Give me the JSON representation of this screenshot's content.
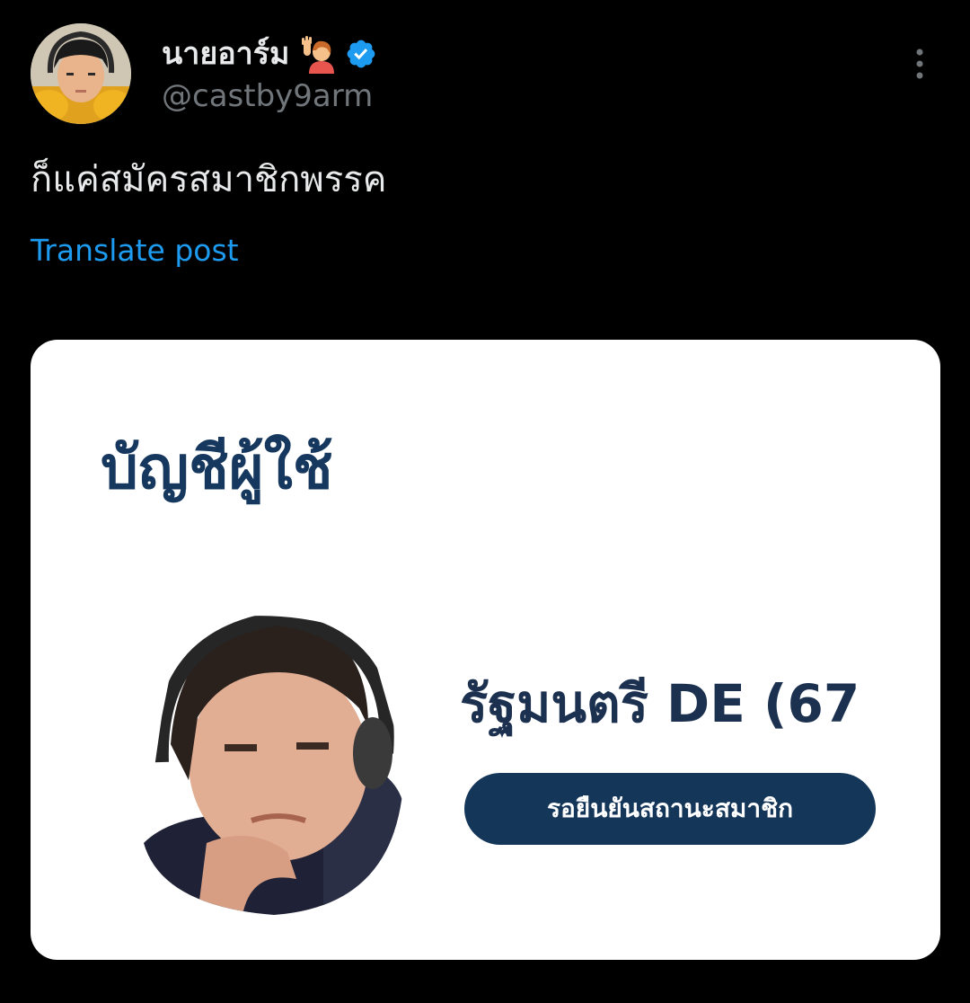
{
  "post": {
    "author": {
      "display_name": "นายอาร์ม",
      "handle": "@castby9arm",
      "verified": true,
      "avatar_icon": "avatar-photo",
      "name_emoji_icon": "person-raising-hand-icon"
    },
    "text": "ก็แค่สมัครสมาชิกพรรค",
    "translate_label": "Translate post",
    "more_icon": "more-vertical-icon"
  },
  "media": {
    "title": "บัญชีผู้ใช้",
    "member_name": "รัฐมนตรี DE (67",
    "status_badge": "รอยืนยันสถานะสมาชิก",
    "photo_icon": "profile-photo"
  },
  "colors": {
    "background": "#000000",
    "text_primary": "#e7e9ea",
    "text_secondary": "#71767b",
    "link": "#1d9bf0",
    "verified": "#1d9bf0",
    "card_background": "#ffffff",
    "card_title": "#16385e",
    "badge_background": "#143659"
  }
}
